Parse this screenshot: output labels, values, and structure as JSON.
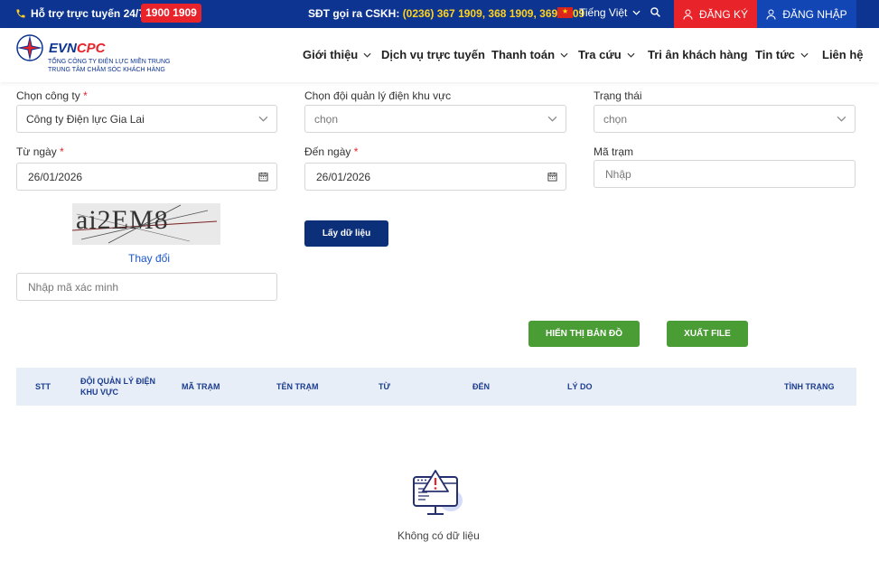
{
  "topbar": {
    "hotline_label": "Hỗ trợ trực tuyến 24/7:",
    "hotline_number": "1900 1909",
    "cskh_label": "SĐT gọi ra CSKH:",
    "cskh_phones": "(0236) 367 1909, 368 1909, 369 1909",
    "language": "Tiếng Việt",
    "register": "ĐĂNG KÝ",
    "login": "ĐĂNG NHẬP"
  },
  "logo": {
    "brand_a": "EVN",
    "brand_b": "CPC",
    "sub1": "TỔNG CÔNG TY ĐIỆN LỰC MIỀN TRUNG",
    "sub2": "TRUNG TÂM CHĂM SÓC KHÁCH HÀNG"
  },
  "nav": {
    "about": "Giới thiệu",
    "online": "Dịch vụ trực tuyến",
    "payment": "Thanh toán",
    "lookup": "Tra cứu",
    "thanks": "Tri ân khách hàng",
    "news": "Tin tức",
    "contact": "Liên hệ"
  },
  "form": {
    "company_label": "Chọn công ty",
    "company_value": "Công ty Điện lực Gia Lai",
    "team_label": "Chọn đội quản lý điện khu vực",
    "team_value": "chọn",
    "status_label": "Trạng thái",
    "status_value": "chọn",
    "from_label": "Từ ngày",
    "from_value": "26/01/2026",
    "to_label": "Đến ngày",
    "to_value": "26/01/2026",
    "station_label": "Mã trạm",
    "station_placeholder": "Nhập",
    "captcha_text": "ai2EM8",
    "captcha_refresh": "Thay đổi",
    "captcha_placeholder": "Nhập mã xác minh",
    "required_mark": "*",
    "submit": "Lấy dữ liệu",
    "show_map": "HIỂN THỊ BẢN ĐỒ",
    "export": "XUẤT FILE"
  },
  "table": {
    "columns": [
      "STT",
      "ĐỘI QUẢN LÝ ĐIỆN",
      "KHU VỰC",
      "MÃ TRẠM",
      "TÊN TRẠM",
      "TỪ",
      "ĐẾN",
      "LÝ DO",
      "TÌNH TRẠNG"
    ],
    "empty": "Không có dữ liệu"
  },
  "colors": {
    "topbar": "#0c3490",
    "red": "#e8232a",
    "login": "#1246b5",
    "submit": "#0c2f7a",
    "green": "#4a9d34"
  }
}
